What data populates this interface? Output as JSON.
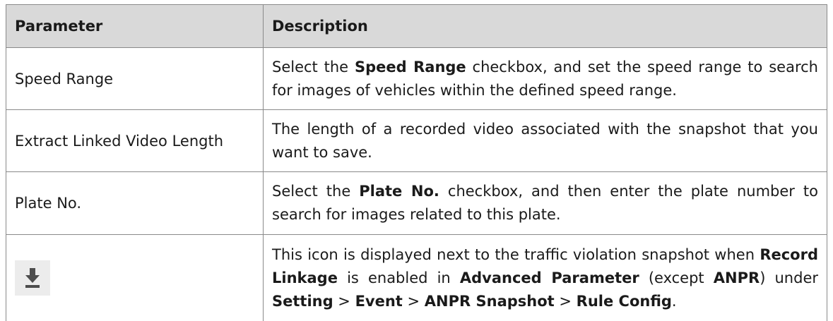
{
  "table": {
    "headers": [
      "Parameter",
      "Description"
    ],
    "rows": [
      {
        "parameter": "Speed Range",
        "description": [
          {
            "text": "Select the ",
            "bold": false
          },
          {
            "text": "Speed Range",
            "bold": true
          },
          {
            "text": " checkbox, and set the speed range to search for images of vehicles within the defined speed range.",
            "bold": false
          }
        ]
      },
      {
        "parameter": "Extract Linked Video Length",
        "description": [
          {
            "text": "The length of a recorded video associated with the snapshot that you want to save.",
            "bold": false
          }
        ]
      },
      {
        "parameter": "Plate No.",
        "description": [
          {
            "text": "Select the ",
            "bold": false
          },
          {
            "text": "Plate No.",
            "bold": true
          },
          {
            "text": " checkbox, and then enter the plate number to search for images related to this plate.",
            "bold": false
          }
        ]
      },
      {
        "parameter_icon": "download-icon",
        "description": [
          {
            "text": "This icon is displayed next to the traffic violation snapshot when ",
            "bold": false
          },
          {
            "text": "Record Linkage",
            "bold": true
          },
          {
            "text": " is enabled in ",
            "bold": false
          },
          {
            "text": "Advanced Parameter",
            "bold": true
          },
          {
            "text": " (except ",
            "bold": false
          },
          {
            "text": "ANPR",
            "bold": true
          },
          {
            "text": ") under ",
            "bold": false
          },
          {
            "text": "Setting",
            "bold": true
          },
          {
            "text": " > ",
            "bold": false
          },
          {
            "text": "Event",
            "bold": true
          },
          {
            "text": " > ",
            "bold": false
          },
          {
            "text": "ANPR Snapshot",
            "bold": true
          },
          {
            "text": " > ",
            "bold": false
          },
          {
            "text": "Rule Config",
            "bold": true
          },
          {
            "text": ".",
            "bold": false
          }
        ]
      }
    ]
  },
  "colors": {
    "header_bg": "#d9d9d9",
    "border": "#8a8a8a",
    "icon_color": "#4d4d4d",
    "icon_bg": "#ececec"
  }
}
